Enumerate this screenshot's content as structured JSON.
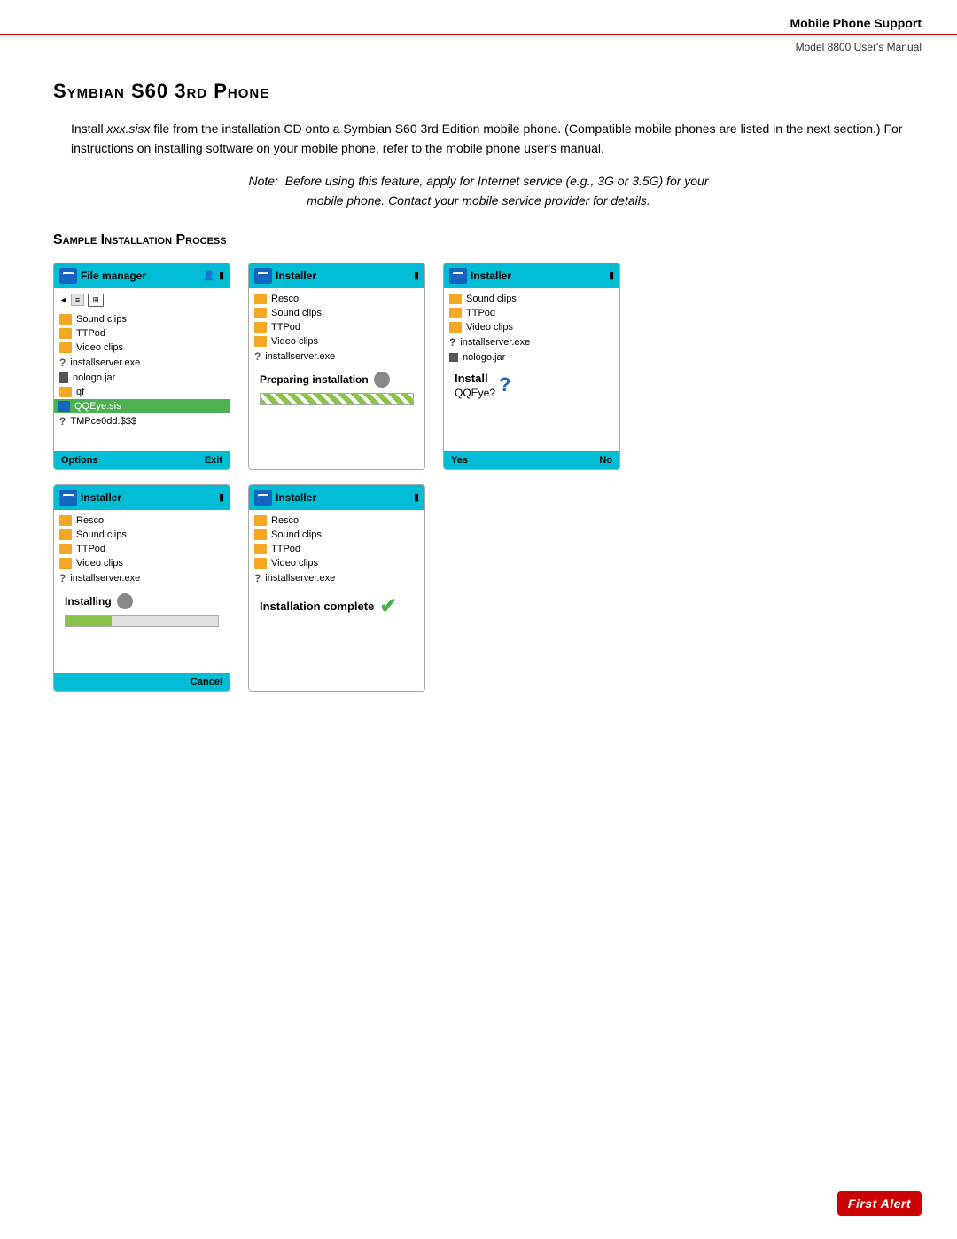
{
  "header": {
    "title": "Mobile Phone Support",
    "subtitle": "Model 8800 User's Manual"
  },
  "page_title": "Symbian S60 3rd Phone",
  "body_text": "Install xxx.sisx file from the installation CD onto a Symbian S60 3rd Edition mobile phone. (Compatible mobile phones are listed in the next section.) For instructions on installing software on your mobile phone, refer to the mobile phone user's manual.",
  "note_text": "Note:  Before using this feature, apply for Internet service (e.g., 3G or 3.5G) for your mobile phone. Contact your mobile service provider for details.",
  "section_heading": "Sample Installation Process",
  "screens": {
    "screen1": {
      "title": "File manager",
      "items": [
        "Sound clips",
        "TTPod",
        "Video clips",
        "installserver.exe",
        "nologo.jar",
        "qf",
        "QQEye.sis",
        "TMPce0dd.$$$"
      ],
      "navbar_left": "Options",
      "navbar_right": "Exit"
    },
    "screen2": {
      "title": "Installer",
      "items": [
        "Resco",
        "Sound clips",
        "TTPod",
        "Video clips",
        "installserver.exe"
      ],
      "status": "Preparing installation",
      "progress": "striped"
    },
    "screen3": {
      "title": "Installer",
      "items": [
        "Sound clips",
        "TTPod",
        "Video clips",
        "installserver.exe",
        "nologo.jar"
      ],
      "install_title": "Install",
      "install_question": "QQEye?",
      "navbar_left": "Yes",
      "navbar_right": "No"
    },
    "screen4": {
      "title": "Installer",
      "items": [
        "Resco",
        "Sound clips",
        "TTPod",
        "Video clips",
        "installserver.exe"
      ],
      "status": "Installing",
      "progress": "partial",
      "navbar_right": "Cancel"
    },
    "screen5": {
      "title": "Installer",
      "items": [
        "Resco",
        "Sound clips",
        "TTPod",
        "Video clips",
        "installserver.exe"
      ],
      "status": "Installation complete",
      "complete": true
    }
  },
  "footer": {
    "logo_text": "First Alert"
  }
}
